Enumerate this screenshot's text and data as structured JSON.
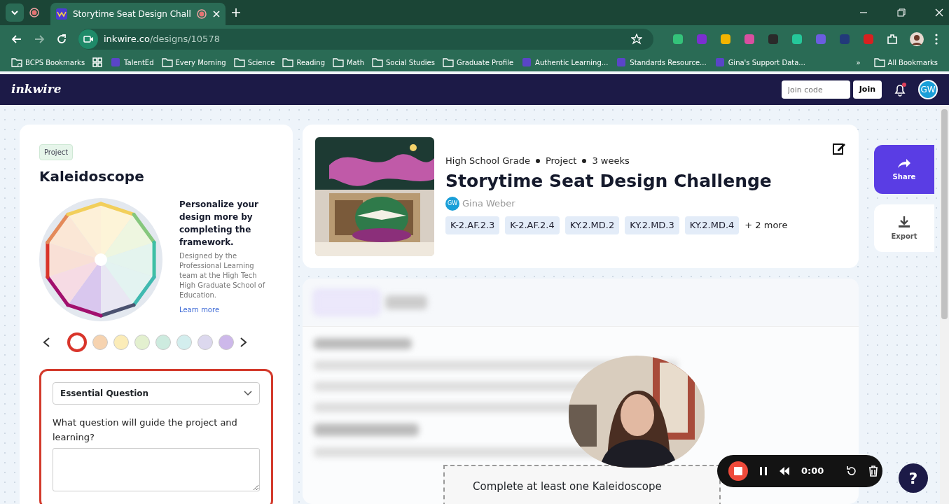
{
  "browser": {
    "tabs": [
      {
        "label": "Storytime Seat Design Chall",
        "selected": true
      }
    ],
    "url_host": "inkwire.co",
    "url_path": "/designs/10578",
    "bookmarks": [
      {
        "label": "BCPS Bookmarks",
        "kind": "managed"
      },
      {
        "label": "TalentEd",
        "kind": "app"
      },
      {
        "label": "Every Morning",
        "kind": "folder"
      },
      {
        "label": "Science",
        "kind": "folder"
      },
      {
        "label": "Reading",
        "kind": "folder"
      },
      {
        "label": "Math",
        "kind": "folder"
      },
      {
        "label": "Social Studies",
        "kind": "folder"
      },
      {
        "label": "Graduate Profile",
        "kind": "folder"
      },
      {
        "label": "Authentic Learning...",
        "kind": "app"
      },
      {
        "label": "Standards Resource...",
        "kind": "app"
      },
      {
        "label": "Gina's Support Data...",
        "kind": "app"
      }
    ],
    "overflow": "»",
    "all_bookmarks": "All Bookmarks"
  },
  "app": {
    "logo": "inkwire",
    "join_placeholder": "Join code",
    "join_button": "Join",
    "has_notification": true,
    "user_initials": "GW"
  },
  "framework": {
    "badge": "Project",
    "title": "Kaleidoscope",
    "prompt": "Personalize your design more by completing the framework.",
    "credit": "Designed by the Professional Learning team at the High Tech High Graduate School of Education.",
    "link": "Learn more",
    "steps": [
      {
        "color": "#d9352b",
        "selected": true
      },
      {
        "color": "#f6d3b0",
        "selected": false
      },
      {
        "color": "#fbecb8",
        "selected": false
      },
      {
        "color": "#e3f0cf",
        "selected": false
      },
      {
        "color": "#cdebdf",
        "selected": false
      },
      {
        "color": "#d3eeee",
        "selected": false
      },
      {
        "color": "#dcd8ee",
        "selected": false
      },
      {
        "color": "#cdb8ea",
        "selected": false
      }
    ],
    "section": "Essential Question",
    "question": "What question will guide the project and learning?"
  },
  "design": {
    "grade": "High School Grade",
    "type": "Project",
    "duration": "3 weeks",
    "title": "Storytime Seat Design Challenge",
    "author_initials": "GW",
    "author": "Gina Weber",
    "standards": [
      "K-2.AF.2.3",
      "K-2.AF.2.4",
      "KY.2.MD.2",
      "KY.2.MD.3",
      "KY.2.MD.4"
    ],
    "more": "+ 2 more"
  },
  "actions": [
    {
      "label": "Share",
      "kind": "share"
    },
    {
      "label": "Export",
      "kind": "export"
    }
  ],
  "tooltip": "Complete at least one Kaleidoscope",
  "recorder": {
    "time": "0:00"
  },
  "help": "?"
}
